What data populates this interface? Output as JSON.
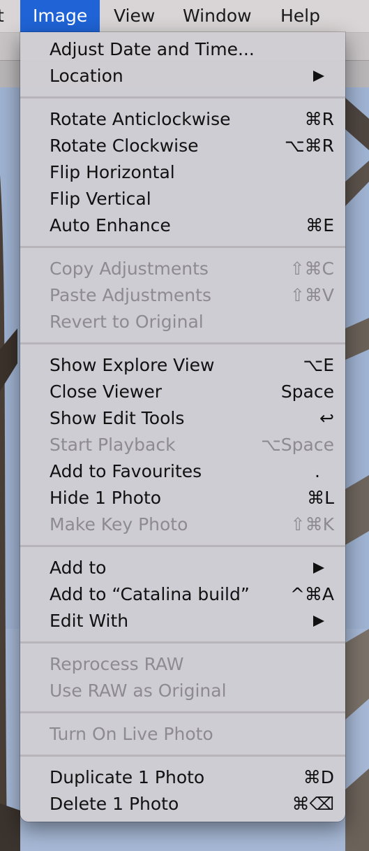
{
  "menubar": {
    "items": [
      {
        "label": "t"
      },
      {
        "label": "Image"
      },
      {
        "label": "View"
      },
      {
        "label": "Window"
      },
      {
        "label": "Help"
      }
    ]
  },
  "menu": {
    "items": [
      {
        "label": "Adjust Date and Time...",
        "shortcut": "",
        "submenu": false,
        "disabled": false
      },
      {
        "label": "Location",
        "shortcut": "",
        "submenu": true,
        "disabled": false
      },
      {
        "label": "Rotate Anticlockwise",
        "shortcut": "⌘R",
        "submenu": false,
        "disabled": false
      },
      {
        "label": "Rotate Clockwise",
        "shortcut": "⌥⌘R",
        "submenu": false,
        "disabled": false
      },
      {
        "label": "Flip Horizontal",
        "shortcut": "",
        "submenu": false,
        "disabled": false
      },
      {
        "label": "Flip Vertical",
        "shortcut": "",
        "submenu": false,
        "disabled": false
      },
      {
        "label": "Auto Enhance",
        "shortcut": "⌘E",
        "submenu": false,
        "disabled": false
      },
      {
        "label": "Copy Adjustments",
        "shortcut": "⇧⌘C",
        "submenu": false,
        "disabled": true
      },
      {
        "label": "Paste Adjustments",
        "shortcut": "⇧⌘V",
        "submenu": false,
        "disabled": true
      },
      {
        "label": "Revert to Original",
        "shortcut": "",
        "submenu": false,
        "disabled": true
      },
      {
        "label": "Show Explore View",
        "shortcut": "⌥E",
        "submenu": false,
        "disabled": false
      },
      {
        "label": "Close Viewer",
        "shortcut": "Space",
        "submenu": false,
        "disabled": false
      },
      {
        "label": "Show Edit Tools",
        "shortcut": "↩",
        "submenu": false,
        "disabled": false
      },
      {
        "label": "Start Playback",
        "shortcut": "⌥Space",
        "submenu": false,
        "disabled": true
      },
      {
        "label": "Add to Favourites",
        "shortcut": ".",
        "submenu": false,
        "disabled": false
      },
      {
        "label": "Hide 1 Photo",
        "shortcut": "⌘L",
        "submenu": false,
        "disabled": false
      },
      {
        "label": "Make Key Photo",
        "shortcut": "⇧⌘K",
        "submenu": false,
        "disabled": true
      },
      {
        "label": "Add to",
        "shortcut": "",
        "submenu": true,
        "disabled": false
      },
      {
        "label": "Add to “Catalina build”",
        "shortcut": "^⌘A",
        "submenu": false,
        "disabled": false
      },
      {
        "label": "Edit With",
        "shortcut": "",
        "submenu": true,
        "disabled": false
      },
      {
        "label": "Reprocess RAW",
        "shortcut": "",
        "submenu": false,
        "disabled": true
      },
      {
        "label": "Use RAW as Original",
        "shortcut": "",
        "submenu": false,
        "disabled": true
      },
      {
        "label": "Turn On Live Photo",
        "shortcut": "",
        "submenu": false,
        "disabled": true
      },
      {
        "label": "Duplicate 1 Photo",
        "shortcut": "⌘D",
        "submenu": false,
        "disabled": false
      },
      {
        "label": "Delete 1 Photo",
        "shortcut": "⌘⌫",
        "submenu": false,
        "disabled": false
      }
    ]
  },
  "colors": {
    "menubar_active": "#1f63d6",
    "menu_background": "#d2cfd4",
    "enabled_text": "#111111",
    "disabled_text": "#8e8b90",
    "sky": "#9fb3d2"
  }
}
